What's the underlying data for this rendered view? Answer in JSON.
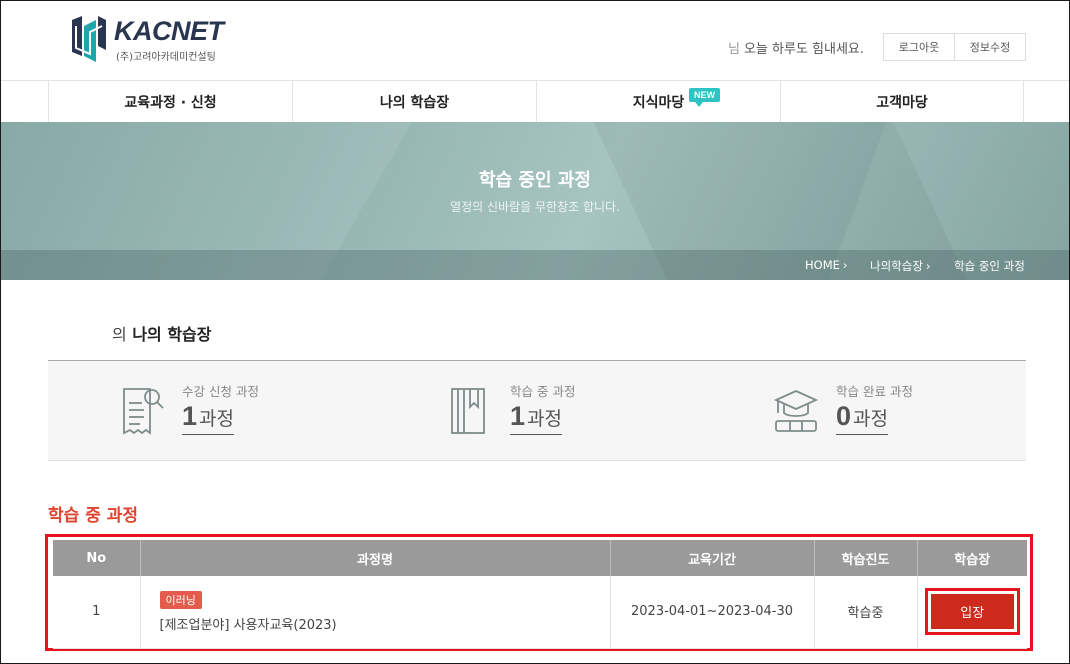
{
  "header": {
    "logo_name": "KACNET",
    "logo_sub": "(주)고려아카데미컨설팅",
    "greeting_prefix": "님",
    "greeting": "오늘 하루도 힘내세요.",
    "logout_label": "로그아웃",
    "edit_info_label": "정보수정"
  },
  "nav": {
    "items": [
      {
        "label": "교육과정 · 신청"
      },
      {
        "label": "나의 학습장"
      },
      {
        "label": "지식마당",
        "badge": "NEW"
      },
      {
        "label": "고객마당"
      }
    ]
  },
  "banner": {
    "title": "학습 중인 과정",
    "subtitle": "열정의 신바람을 무한창조 합니다.",
    "breadcrumb": [
      "HOME",
      "나의학습장",
      "학습 중인 과정"
    ]
  },
  "my_study": {
    "title_prefix": "의",
    "title": "나의 학습장",
    "summary": [
      {
        "label": "수강 신청 과정",
        "count": "1",
        "unit": "과정",
        "icon": "application-form-icon"
      },
      {
        "label": "학습 중 과정",
        "count": "1",
        "unit": "과정",
        "icon": "book-icon"
      },
      {
        "label": "학습 완료 과정",
        "count": "0",
        "unit": "과정",
        "icon": "graduation-cap-icon"
      }
    ]
  },
  "courses": {
    "title": "학습 중 과정",
    "columns": [
      "No",
      "과정명",
      "교육기간",
      "학습진도",
      "학습장"
    ],
    "rows": [
      {
        "no": "1",
        "tag": "이러닝",
        "name": "[제조업분야] 사용자교육(2023)",
        "period": "2023-04-01~2023-04-30",
        "progress": "학습중",
        "action": "입장"
      }
    ]
  },
  "colors": {
    "accent_red": "#e0432f",
    "button_red": "#cc2a1d",
    "highlight_border": "#e8131d",
    "new_badge": "#2ec3c4",
    "banner_teal": "#93b4b0",
    "table_header": "#9a9a9a"
  }
}
